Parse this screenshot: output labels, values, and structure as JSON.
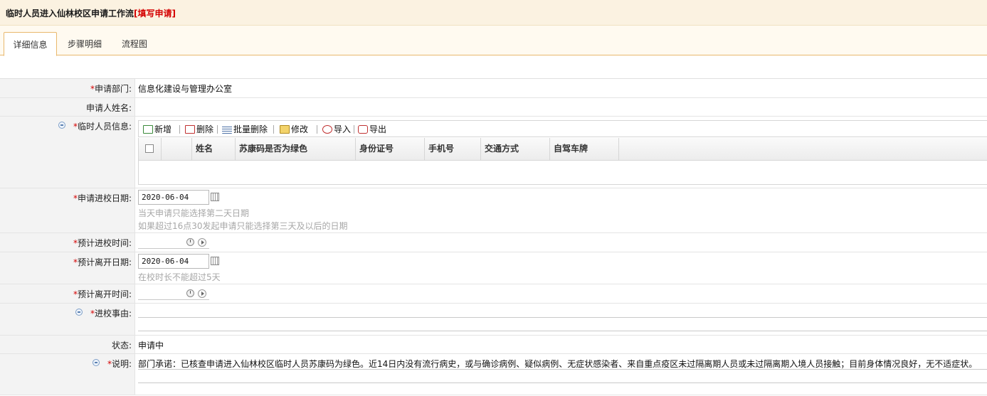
{
  "header": {
    "title": "临时人员进入仙林校区申请工作流",
    "mode": "[填写申请]"
  },
  "tabs": [
    {
      "label": "详细信息",
      "active": true
    },
    {
      "label": "步骤明细",
      "active": false
    },
    {
      "label": "流程图",
      "active": false
    }
  ],
  "form": {
    "dept": {
      "label": "申请部门:",
      "value": "信息化建设与管理办公室"
    },
    "applicant": {
      "label": "申请人姓名:",
      "value": ""
    },
    "temp_staff": {
      "label": "临时人员信息:",
      "toolbar": {
        "add": "新增",
        "delete": "删除",
        "batch_delete": "批量删除",
        "edit": "修改",
        "import": "导入",
        "export": "导出"
      },
      "columns": [
        "姓名",
        "苏康码是否为绿色",
        "身份证号",
        "手机号",
        "交通方式",
        "自驾车牌"
      ]
    },
    "entry_date": {
      "label": "申请进校日期:",
      "value": "2020-06-04",
      "hint1": "当天申请只能选择第二天日期",
      "hint2": "如果超过16点30发起申请只能选择第三天及以后的日期"
    },
    "entry_time": {
      "label": "预计进校时间:",
      "value": ""
    },
    "leave_date": {
      "label": "预计离开日期:",
      "value": "2020-06-04",
      "hint": "在校时长不能超过5天"
    },
    "leave_time": {
      "label": "预计离开时间:",
      "value": ""
    },
    "reason": {
      "label": "进校事由:",
      "value": ""
    },
    "status": {
      "label": "状态:",
      "value": "申请中"
    },
    "note": {
      "label": "说明:",
      "value": "部门承诺：已核查申请进入仙林校区临时人员苏康码为绿色。近14日内没有流行病史，或与确诊病例、疑似病例、无症状感染者、来自重点疫区未过隔离期人员或未过隔离期入境人员接触；目前身体情况良好，无不适症状。"
    },
    "required_mark": "*"
  },
  "colors": {
    "required": "#d40000",
    "header_bg": "#fbf2e1",
    "tab_border": "#e9b86d"
  }
}
